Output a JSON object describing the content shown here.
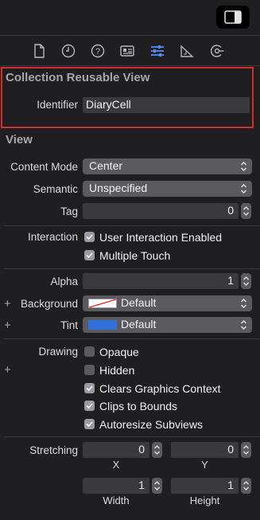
{
  "tabs": [
    {
      "name": "file-inspector",
      "icon": "document-icon"
    },
    {
      "name": "history-inspector",
      "icon": "clock-icon"
    },
    {
      "name": "quick-help",
      "icon": "question-icon"
    },
    {
      "name": "identity-inspector",
      "icon": "id-card-icon"
    },
    {
      "name": "attributes-inspector",
      "icon": "sliders-icon",
      "selected": true
    },
    {
      "name": "size-inspector",
      "icon": "ruler-icon"
    },
    {
      "name": "connections-inspector",
      "icon": "connection-arrow-icon"
    }
  ],
  "colors": {
    "accent": "#4a90f7",
    "highlight_border": "#d62c2c"
  },
  "reusable": {
    "title": "Collection Reusable View",
    "identifier_label": "Identifier",
    "identifier_value": "DiaryCell"
  },
  "view": {
    "title": "View",
    "content_mode_label": "Content Mode",
    "content_mode_value": "Center",
    "semantic_label": "Semantic",
    "semantic_value": "Unspecified",
    "tag_label": "Tag",
    "tag_value": "0",
    "interaction_label": "Interaction",
    "user_interaction_label": "User Interaction Enabled",
    "user_interaction_checked": true,
    "multiple_touch_label": "Multiple Touch",
    "multiple_touch_checked": true,
    "alpha_label": "Alpha",
    "alpha_value": "1",
    "background_label": "Background",
    "background_value": "Default",
    "tint_label": "Tint",
    "tint_value": "Default",
    "tint_color": "#2f6fd6",
    "drawing_label": "Drawing",
    "opaque_label": "Opaque",
    "opaque_checked": false,
    "hidden_label": "Hidden",
    "hidden_checked": false,
    "clears_label": "Clears Graphics Context",
    "clears_checked": true,
    "clips_label": "Clips to Bounds",
    "clips_checked": true,
    "autoresize_label": "Autoresize Subviews",
    "autoresize_checked": true,
    "stretching_label": "Stretching",
    "stretch_x": "0",
    "stretch_y": "0",
    "stretch_width": "1",
    "stretch_height": "1",
    "x_label": "X",
    "y_label": "Y",
    "width_label": "Width",
    "height_label": "Height"
  }
}
